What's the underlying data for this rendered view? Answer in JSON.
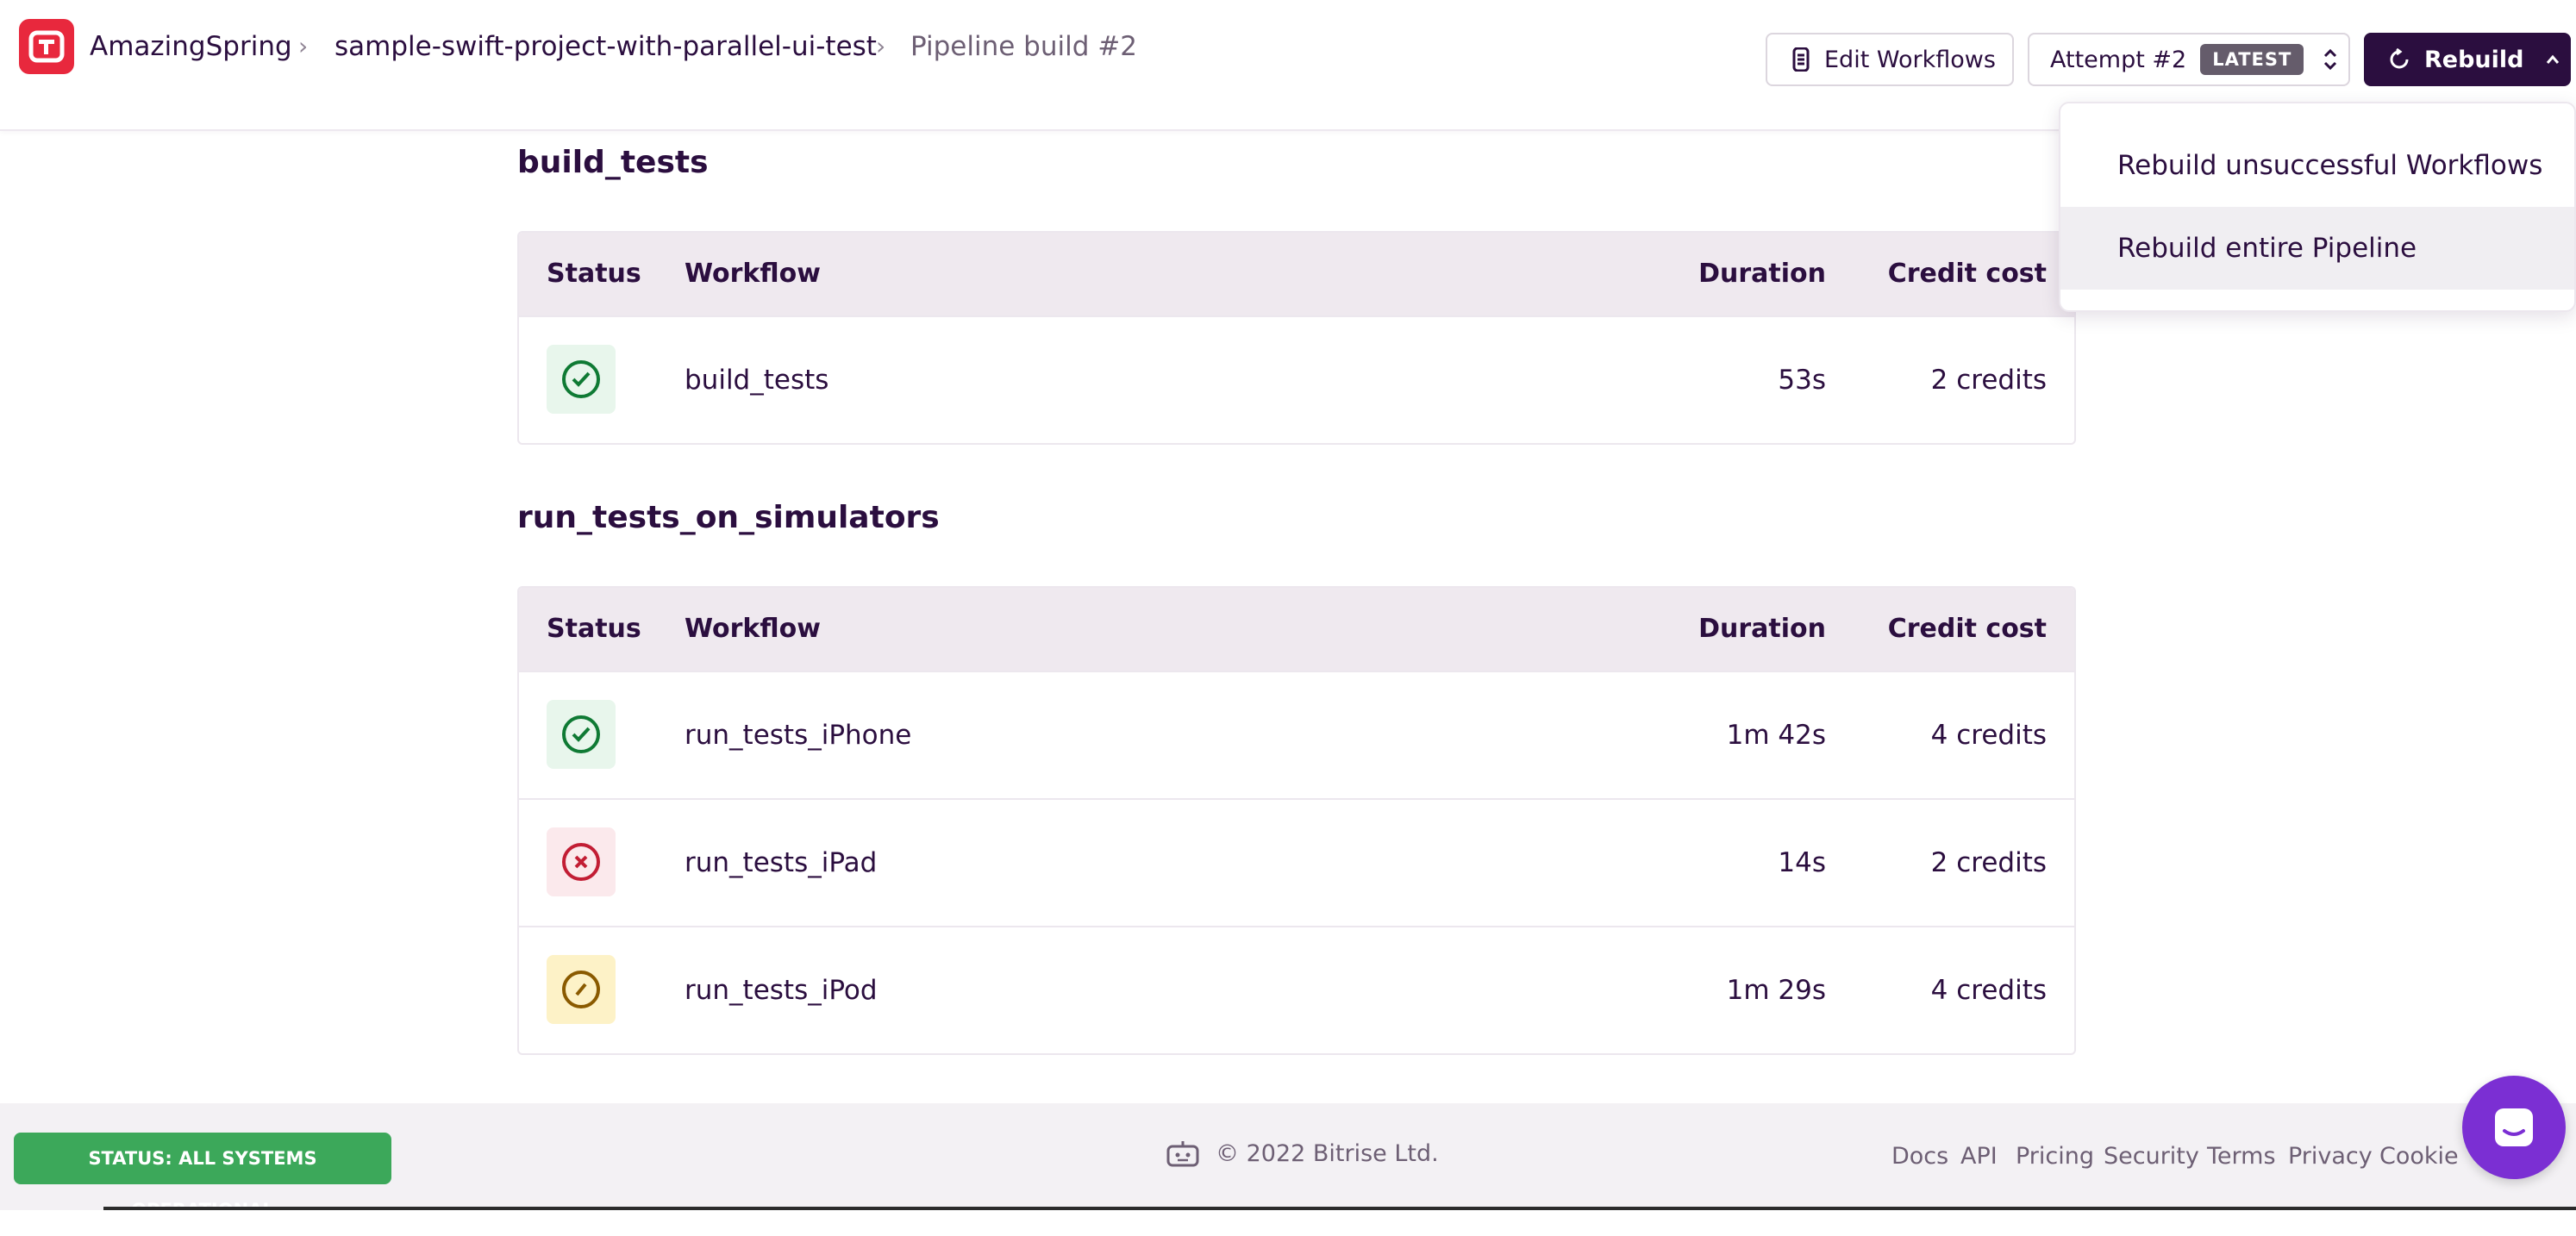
{
  "breadcrumb": {
    "app": "AmazingSpring",
    "project": "sample-swift-project-with-parallel-ui-test",
    "current": "Pipeline build #2"
  },
  "toolbar": {
    "edit_workflows": "Edit Workflows",
    "attempt": "Attempt #2",
    "attempt_badge": "LATEST",
    "rebuild": "Rebuild"
  },
  "rebuild_menu": {
    "items": [
      "Rebuild unsuccessful Workflows",
      "Rebuild entire Pipeline"
    ]
  },
  "columns": {
    "status": "Status",
    "workflow": "Workflow",
    "duration": "Duration",
    "credit_cost": "Credit cost"
  },
  "stages": [
    {
      "name": "build_tests",
      "workflows": [
        {
          "status": "success",
          "name": "build_tests",
          "duration": "53s",
          "cost": "2 credits"
        }
      ]
    },
    {
      "name": "run_tests_on_simulators",
      "workflows": [
        {
          "status": "success",
          "name": "run_tests_iPhone",
          "duration": "1m 42s",
          "cost": "4 credits"
        },
        {
          "status": "failed",
          "name": "run_tests_iPad",
          "duration": "14s",
          "cost": "2 credits"
        },
        {
          "status": "aborted",
          "name": "run_tests_iPod",
          "duration": "1m 29s",
          "cost": "4 credits"
        }
      ]
    }
  ],
  "footer": {
    "status": "STATUS: ALL SYSTEMS OPERATIONAL",
    "copyright": "© 2022 Bitrise Ltd.",
    "links": [
      "Docs",
      "API",
      "Pricing",
      "Security",
      "Terms",
      "Privacy",
      "Cookie"
    ]
  },
  "colors": {
    "brand_dark": "#2b0e3f",
    "logo_red": "#e8283d",
    "success": "#0f7a34",
    "failed": "#c21d34",
    "aborted": "#8a5a00",
    "status_green": "#3ca85a",
    "chat_purple": "#7b2fd3"
  },
  "icons": {
    "edit": "workflow-editor-icon",
    "attempt": "up-down-chevron-icon",
    "rebuild": "refresh-icon",
    "success": "check-circle-icon",
    "failed": "x-circle-icon",
    "aborted": "slash-circle-icon",
    "chat": "chat-icon"
  }
}
